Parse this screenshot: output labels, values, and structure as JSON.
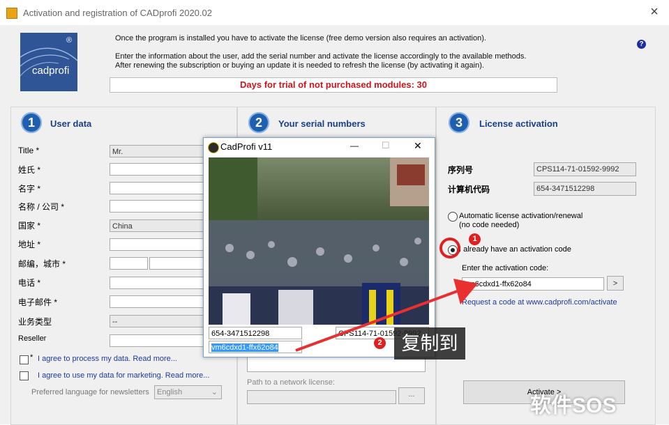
{
  "window": {
    "title": "Activation and registration of CADprofi 2020.02",
    "close": "×"
  },
  "logo": {
    "text": "cadprofi",
    "reg": "®"
  },
  "intro": {
    "line1": "Once the program is installed you have to activate the license (free demo version also requires an activation).",
    "line2": "Enter the information about the user, add the serial number and activate the license accordingly to the available methods.",
    "line3": "After renewing the subscription or buying an update it is needed to refresh the license (by activating it again)."
  },
  "help": "?",
  "trial_banner": "Days for trial of not purchased modules: 30",
  "user_panel": {
    "number": "1",
    "heading": "User data",
    "fields": [
      {
        "label": "Title *",
        "value": "Mr."
      },
      {
        "label": "姓氏 *",
        "value": ""
      },
      {
        "label": "名字 *",
        "value": ""
      },
      {
        "label": "名称 / 公司 *",
        "value": ""
      },
      {
        "label": "国家 *",
        "value": "China"
      },
      {
        "label": "地址 *",
        "value": ""
      },
      {
        "label": "邮编，城市 *",
        "value": ""
      },
      {
        "label": "电话 *",
        "value": ""
      },
      {
        "label": "电子邮件 *",
        "value": ""
      },
      {
        "label": "业务类型",
        "value": "--"
      },
      {
        "label": "Reseller",
        "value": ""
      }
    ],
    "agree1_star": "*",
    "agree1": "I agree to process my data. Read more...",
    "agree2": "I agree to use my data for marketing. Read more...",
    "lang_label": "Preferred language for newsletters",
    "lang_value": "English"
  },
  "serial_panel": {
    "number": "2",
    "heading": "Your serial numbers",
    "network_label": "Path to a network license:",
    "browse": "..."
  },
  "license_panel": {
    "number": "3",
    "heading": "License activation",
    "serial_label": "序列号",
    "serial_value": "CPS114-71-01592-9992",
    "computer_label": "计算机代码",
    "computer_value": "654-3471512298",
    "opt_auto": "Automatic license activation/renewal",
    "opt_auto_sub": "(no code needed)",
    "opt_code": "I already have an activation code",
    "enter_label": "Enter the activation code:",
    "code_value": "vm6cdxd1-ffx62o84",
    "go": ">",
    "request_link": "Request a code at www.cadprofi.com/activate",
    "activate": "Activate >"
  },
  "dialog": {
    "title": "CadProfi v11",
    "minimize": "—",
    "maximize": "☐",
    "close": "✕",
    "computer_code": "654-3471512298",
    "serial": "CPS114-71-01592-9992",
    "activation_code": "vm6cdxd1-ffx62o84"
  },
  "annotations": {
    "badge1": "1",
    "badge2": "2",
    "copy_label": "复制到",
    "watermark": "软件SOS"
  }
}
